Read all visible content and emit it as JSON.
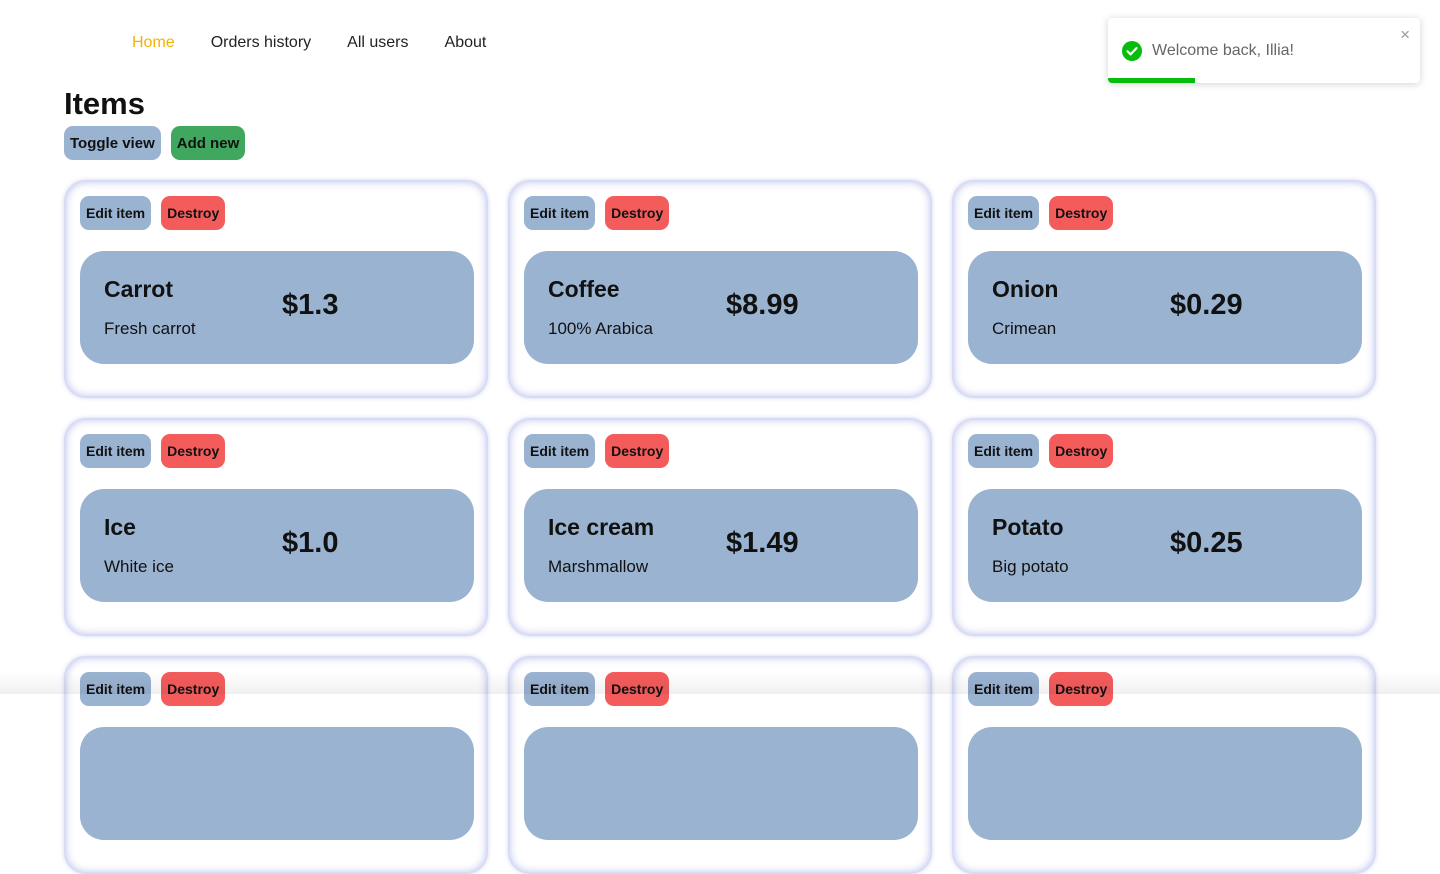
{
  "nav": {
    "items": [
      {
        "label": "Home",
        "active": true
      },
      {
        "label": "Orders history"
      },
      {
        "label": "All users"
      },
      {
        "label": "About"
      }
    ]
  },
  "page": {
    "title": "Items",
    "toggle_view_label": "Toggle view",
    "add_new_label": "Add new"
  },
  "card_actions": {
    "edit_label": "Edit item",
    "destroy_label": "Destroy"
  },
  "items": [
    {
      "name": "Carrot",
      "description": "Fresh carrot",
      "price": "$1.3"
    },
    {
      "name": "Coffee",
      "description": "100% Arabica",
      "price": "$8.99"
    },
    {
      "name": "Onion",
      "description": "Crimean",
      "price": "$0.29"
    },
    {
      "name": "Ice",
      "description": "White ice",
      "price": "$1.0"
    },
    {
      "name": "Ice cream",
      "description": "Marshmallow",
      "price": "$1.49"
    },
    {
      "name": "Potato",
      "description": "Big potato",
      "price": "$0.25"
    },
    {
      "name": "",
      "description": "",
      "price": ""
    },
    {
      "name": "",
      "description": "",
      "price": ""
    },
    {
      "name": "",
      "description": "",
      "price": ""
    }
  ],
  "toast": {
    "message": "Welcome back, Illia!",
    "close_glyph": "×",
    "progress": 0.28
  },
  "colors": {
    "accent_active_nav": "#f3b300",
    "item_box": "#9ab3d1",
    "edit_button": "#9ab3d1",
    "destroy_button": "#f45c5c",
    "add_button": "#3fa85e",
    "toast_success": "#07bc0c"
  },
  "icons": {
    "toast": "check-circle-icon",
    "close": "close-icon"
  }
}
